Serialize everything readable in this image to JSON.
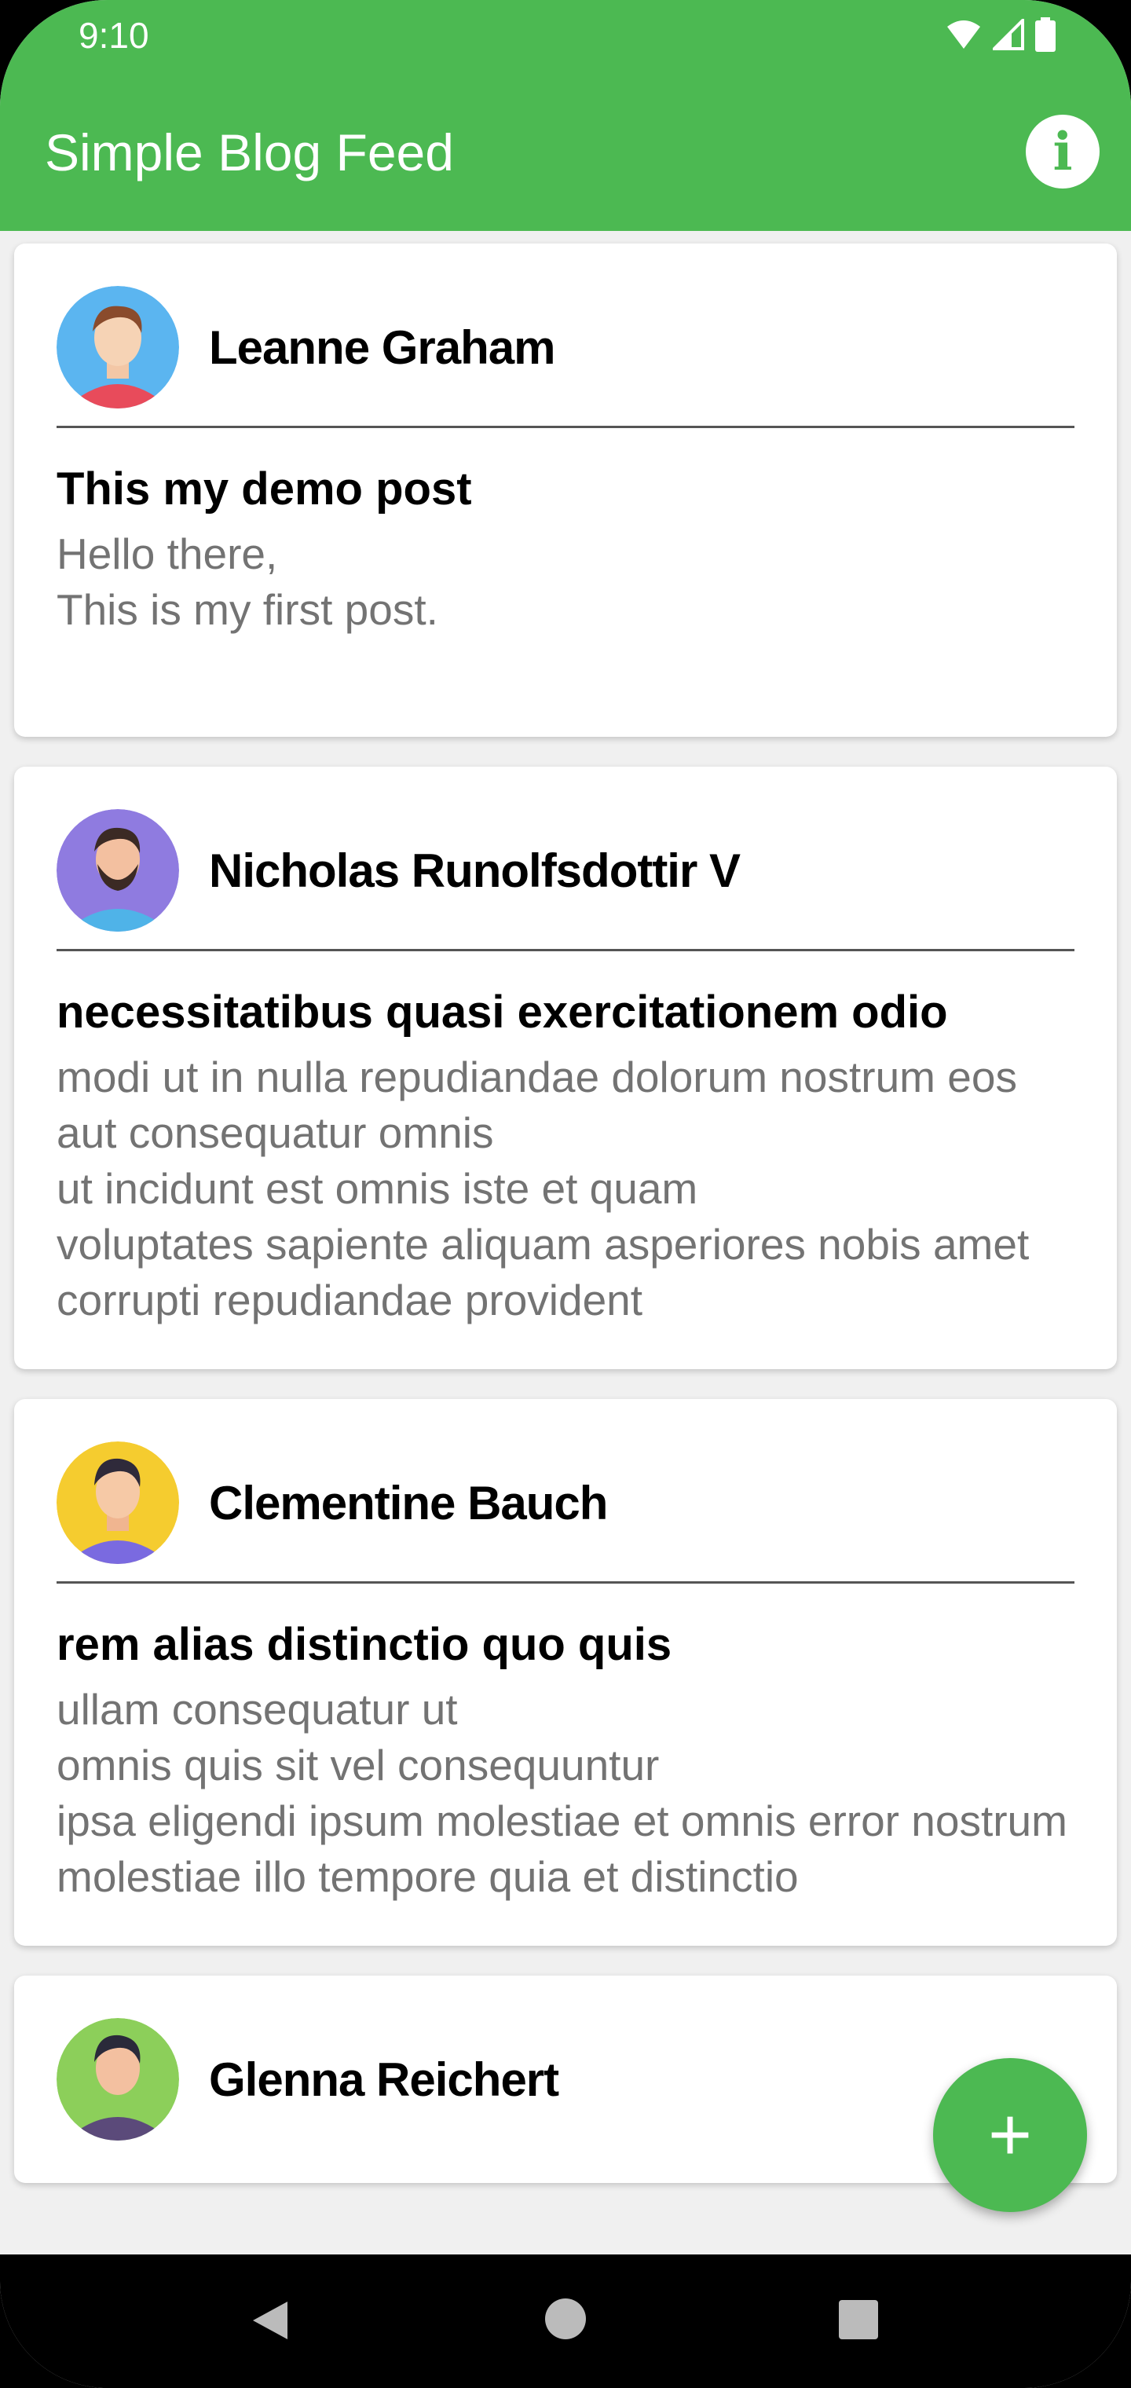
{
  "status_bar": {
    "time": "9:10"
  },
  "app_bar": {
    "title": "Simple Blog Feed",
    "info_icon": "info-icon"
  },
  "posts": [
    {
      "author": "Leanne Graham",
      "avatar_bg": "#5bb5f0",
      "title": "This my demo post",
      "body": "Hello there,\nThis is my first post."
    },
    {
      "author": "Nicholas Runolfsdottir V",
      "avatar_bg": "#8f7be0",
      "title": "necessitatibus quasi exercitationem odio",
      "body": "modi ut in nulla repudiandae dolorum nostrum eos\naut consequatur omnis\nut incidunt est omnis iste et quam\nvoluptates sapiente aliquam asperiores nobis amet corrupti repudiandae provident"
    },
    {
      "author": "Clementine Bauch",
      "avatar_bg": "#f5cc2f",
      "title": "rem alias distinctio quo quis",
      "body": "ullam consequatur ut\nomnis quis sit vel consequuntur\nipsa eligendi ipsum molestiae et omnis error nostrum\nmolestiae illo tempore quia et distinctio"
    },
    {
      "author": "Glenna Reichert",
      "avatar_bg": "#8ccf5a",
      "title": "",
      "body": ""
    }
  ],
  "fab": {
    "label": "+"
  },
  "colors": {
    "primary": "#4cb952",
    "text_secondary": "#737373"
  }
}
